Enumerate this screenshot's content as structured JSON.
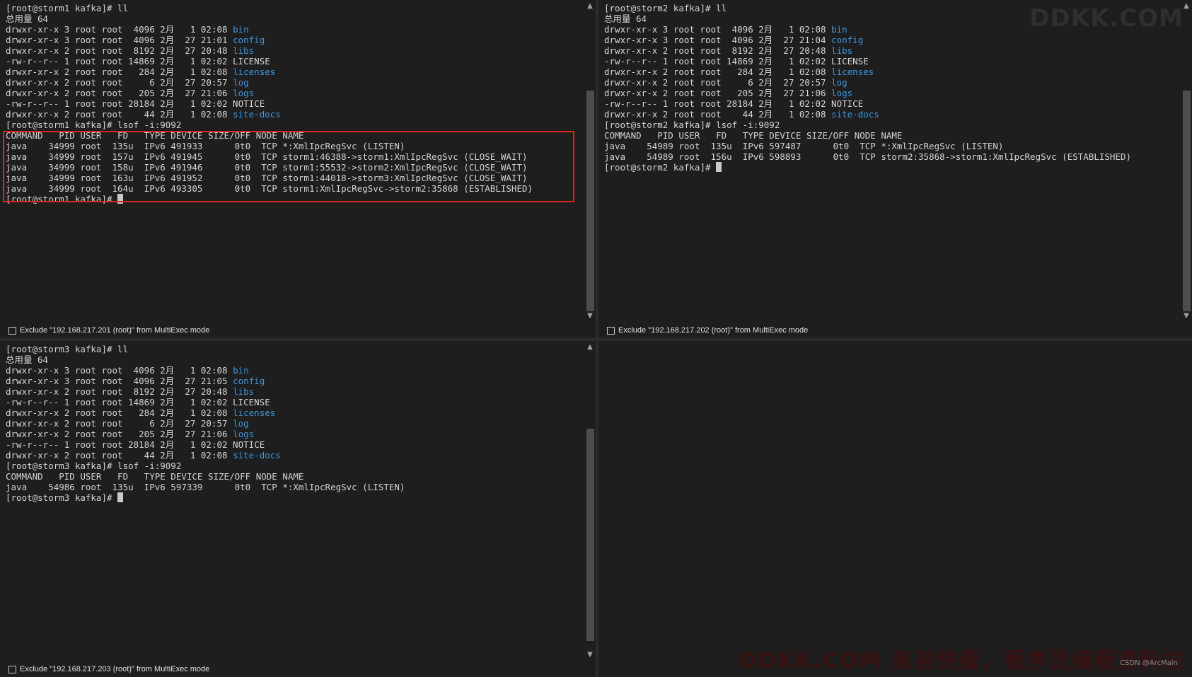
{
  "panes": [
    {
      "id": "storm1",
      "exclude_label": "Exclude \"192.168.217.201 (root)\" from MultiExec mode",
      "lines": [
        [
          {
            "t": "[root@storm1 kafka]# ll"
          }
        ],
        [
          {
            "t": "总用量 64"
          }
        ],
        [
          {
            "t": "drwxr-xr-x 3 root root  4096 2月   1 02:08 "
          },
          {
            "t": "bin",
            "c": "dir"
          }
        ],
        [
          {
            "t": "drwxr-xr-x 3 root root  4096 2月  27 21:01 "
          },
          {
            "t": "config",
            "c": "dir"
          }
        ],
        [
          {
            "t": "drwxr-xr-x 2 root root  8192 2月  27 20:48 "
          },
          {
            "t": "libs",
            "c": "dir"
          }
        ],
        [
          {
            "t": "-rw-r--r-- 1 root root 14869 2月   1 02:02 LICENSE"
          }
        ],
        [
          {
            "t": "drwxr-xr-x 2 root root   284 2月   1 02:08 "
          },
          {
            "t": "licenses",
            "c": "dir"
          }
        ],
        [
          {
            "t": "drwxr-xr-x 2 root root     6 2月  27 20:57 "
          },
          {
            "t": "log",
            "c": "dir"
          }
        ],
        [
          {
            "t": "drwxr-xr-x 2 root root   205 2月  27 21:06 "
          },
          {
            "t": "logs",
            "c": "dir"
          }
        ],
        [
          {
            "t": "-rw-r--r-- 1 root root 28184 2月   1 02:02 NOTICE"
          }
        ],
        [
          {
            "t": "drwxr-xr-x 2 root root    44 2月   1 02:08 "
          },
          {
            "t": "site-docs",
            "c": "dir"
          }
        ],
        [
          {
            "t": "[root@storm1 kafka]# lsof -i:9092"
          }
        ],
        [
          {
            "t": "COMMAND   PID USER   FD   TYPE DEVICE SIZE/OFF NODE NAME"
          }
        ],
        [
          {
            "t": "java    34999 root  135u  IPv6 491933      0t0  TCP *:XmlIpcRegSvc (LISTEN)"
          }
        ],
        [
          {
            "t": "java    34999 root  157u  IPv6 491945      0t0  TCP storm1:46388->storm1:XmlIpcRegSvc (CLOSE_WAIT)"
          }
        ],
        [
          {
            "t": "java    34999 root  158u  IPv6 491946      0t0  TCP storm1:55532->storm2:XmlIpcRegSvc (CLOSE_WAIT)"
          }
        ],
        [
          {
            "t": "java    34999 root  163u  IPv6 491952      0t0  TCP storm1:44018->storm3:XmlIpcRegSvc (CLOSE_WAIT)"
          }
        ],
        [
          {
            "t": "java    34999 root  164u  IPv6 493305      0t0  TCP storm1:XmlIpcRegSvc->storm2:35868 (ESTABLISHED)"
          }
        ],
        [
          {
            "t": "[root@storm1 kafka]# "
          },
          {
            "t": "",
            "c": "cursor"
          }
        ]
      ]
    },
    {
      "id": "storm2",
      "exclude_label": "Exclude \"192.168.217.202 (root)\" from MultiExec mode",
      "lines": [
        [
          {
            "t": "[root@storm2 kafka]# ll"
          }
        ],
        [
          {
            "t": "总用量 64"
          }
        ],
        [
          {
            "t": "drwxr-xr-x 3 root root  4096 2月   1 02:08 "
          },
          {
            "t": "bin",
            "c": "dir"
          }
        ],
        [
          {
            "t": "drwxr-xr-x 3 root root  4096 2月  27 21:04 "
          },
          {
            "t": "config",
            "c": "dir"
          }
        ],
        [
          {
            "t": "drwxr-xr-x 2 root root  8192 2月  27 20:48 "
          },
          {
            "t": "libs",
            "c": "dir"
          }
        ],
        [
          {
            "t": "-rw-r--r-- 1 root root 14869 2月   1 02:02 LICENSE"
          }
        ],
        [
          {
            "t": "drwxr-xr-x 2 root root   284 2月   1 02:08 "
          },
          {
            "t": "licenses",
            "c": "dir"
          }
        ],
        [
          {
            "t": "drwxr-xr-x 2 root root     6 2月  27 20:57 "
          },
          {
            "t": "log",
            "c": "dir"
          }
        ],
        [
          {
            "t": "drwxr-xr-x 2 root root   205 2月  27 21:06 "
          },
          {
            "t": "logs",
            "c": "dir"
          }
        ],
        [
          {
            "t": "-rw-r--r-- 1 root root 28184 2月   1 02:02 NOTICE"
          }
        ],
        [
          {
            "t": "drwxr-xr-x 2 root root    44 2月   1 02:08 "
          },
          {
            "t": "site-docs",
            "c": "dir"
          }
        ],
        [
          {
            "t": "[root@storm2 kafka]# lsof -i:9092"
          }
        ],
        [
          {
            "t": "COMMAND   PID USER   FD   TYPE DEVICE SIZE/OFF NODE NAME"
          }
        ],
        [
          {
            "t": "java    54989 root  135u  IPv6 597487      0t0  TCP *:XmlIpcRegSvc (LISTEN)"
          }
        ],
        [
          {
            "t": "java    54989 root  156u  IPv6 598893      0t0  TCP storm2:35868->storm1:XmlIpcRegSvc (ESTABLISHED)"
          }
        ],
        [
          {
            "t": "[root@storm2 kafka]# "
          },
          {
            "t": "",
            "c": "cursor"
          }
        ]
      ]
    },
    {
      "id": "storm3",
      "exclude_label": "Exclude \"192.168.217.203 (root)\" from MultiExec mode",
      "lines": [
        [
          {
            "t": "[root@storm3 kafka]# ll"
          }
        ],
        [
          {
            "t": "总用量 64"
          }
        ],
        [
          {
            "t": "drwxr-xr-x 3 root root  4096 2月   1 02:08 "
          },
          {
            "t": "bin",
            "c": "dir"
          }
        ],
        [
          {
            "t": "drwxr-xr-x 3 root root  4096 2月  27 21:05 "
          },
          {
            "t": "config",
            "c": "dir"
          }
        ],
        [
          {
            "t": "drwxr-xr-x 2 root root  8192 2月  27 20:48 "
          },
          {
            "t": "libs",
            "c": "dir"
          }
        ],
        [
          {
            "t": "-rw-r--r-- 1 root root 14869 2月   1 02:02 LICENSE"
          }
        ],
        [
          {
            "t": "drwxr-xr-x 2 root root   284 2月   1 02:08 "
          },
          {
            "t": "licenses",
            "c": "dir"
          }
        ],
        [
          {
            "t": "drwxr-xr-x 2 root root     6 2月  27 20:57 "
          },
          {
            "t": "log",
            "c": "dir"
          }
        ],
        [
          {
            "t": "drwxr-xr-x 2 root root   205 2月  27 21:06 "
          },
          {
            "t": "logs",
            "c": "dir"
          }
        ],
        [
          {
            "t": "-rw-r--r-- 1 root root 28184 2月   1 02:02 NOTICE"
          }
        ],
        [
          {
            "t": "drwxr-xr-x 2 root root    44 2月   1 02:08 "
          },
          {
            "t": "site-docs",
            "c": "dir"
          }
        ],
        [
          {
            "t": "[root@storm3 kafka]# lsof -i:9092"
          }
        ],
        [
          {
            "t": "COMMAND   PID USER   FD   TYPE DEVICE SIZE/OFF NODE NAME"
          }
        ],
        [
          {
            "t": "java    54986 root  135u  IPv6 597339      0t0  TCP *:XmlIpcRegSvc (LISTEN)"
          }
        ],
        [
          {
            "t": "[root@storm3 kafka]# "
          },
          {
            "t": "",
            "c": "cursor"
          }
        ]
      ]
    }
  ],
  "watermarks": {
    "top": "DDKK.COM",
    "bottom": "DDKK.COM 弟弟快看，程序员编程资料站",
    "small": "CSDN @ArcMain"
  },
  "colors": {
    "background": "#1e1e1e",
    "text": "#d4d4d4",
    "directory": "#3a96dd",
    "highlight_box": "#e0261b"
  }
}
